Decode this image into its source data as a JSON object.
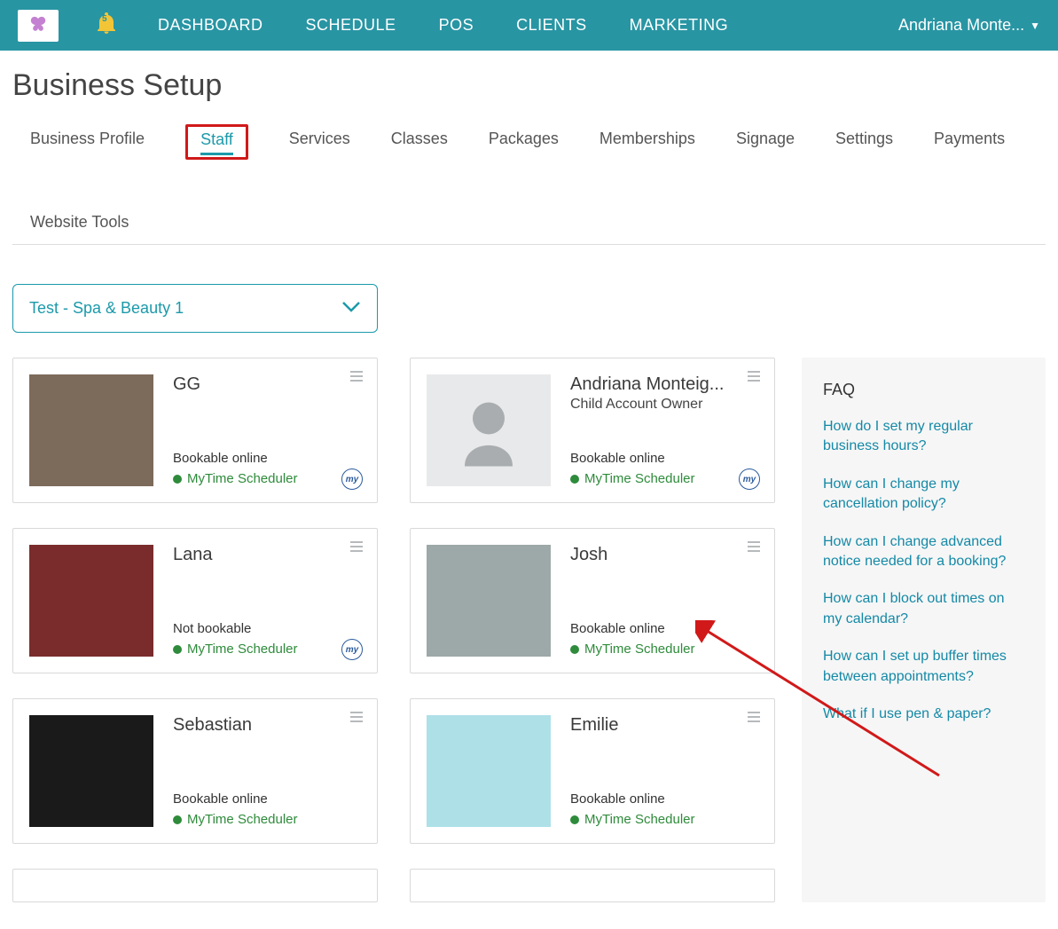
{
  "nav": {
    "items": [
      "DASHBOARD",
      "SCHEDULE",
      "POS",
      "CLIENTS",
      "MARKETING"
    ],
    "user_label": "Andriana Monte...",
    "bell_count": "5"
  },
  "page_title": "Business Setup",
  "tabs": {
    "items": [
      "Business Profile",
      "Staff",
      "Services",
      "Classes",
      "Packages",
      "Memberships",
      "Signage",
      "Settings",
      "Payments",
      "Website Tools"
    ],
    "active_index": 1
  },
  "location_select": {
    "label": "Test - Spa & Beauty 1"
  },
  "scheduler_label": "MyTime Scheduler",
  "mt_badge_label": "my",
  "staff": [
    {
      "name": "GG",
      "subtitle": "",
      "bookable": "Bookable online",
      "placeholder": false,
      "badge": true,
      "avatar_bg": "#7c6a5a"
    },
    {
      "name": "Andriana Monteig...",
      "subtitle": "Child Account Owner",
      "bookable": "Bookable online",
      "placeholder": true,
      "badge": true,
      "avatar_bg": "#e8e9ea"
    },
    {
      "name": "Lana",
      "subtitle": "",
      "bookable": "Not bookable",
      "placeholder": false,
      "badge": true,
      "avatar_bg": "#7a2c2c"
    },
    {
      "name": "Josh",
      "subtitle": "",
      "bookable": "Bookable online",
      "placeholder": false,
      "badge": false,
      "avatar_bg": "#9da8a8"
    },
    {
      "name": "Sebastian",
      "subtitle": "",
      "bookable": "Bookable online",
      "placeholder": false,
      "badge": false,
      "avatar_bg": "#1a1a1a"
    },
    {
      "name": "Emilie",
      "subtitle": "",
      "bookable": "Bookable online",
      "placeholder": false,
      "badge": false,
      "avatar_bg": "#aee0e8"
    }
  ],
  "faq": {
    "title": "FAQ",
    "links": [
      "How do I set my regular business hours?",
      "How can I change my cancellation policy?",
      "How can I change advanced notice needed for a booking?",
      "How can I block out times on my calendar?",
      "How can I set up buffer times between appointments?",
      "What if I use pen & paper?"
    ]
  }
}
